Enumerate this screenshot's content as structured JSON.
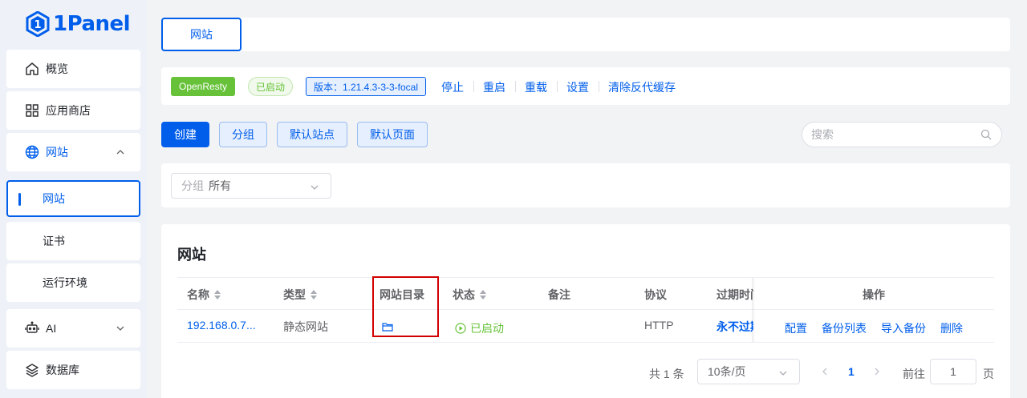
{
  "app": {
    "name": "1Panel"
  },
  "sidebar": {
    "items": [
      {
        "label": "概览",
        "icon": "home-icon"
      },
      {
        "label": "应用商店",
        "icon": "grid-icon"
      },
      {
        "label": "网站",
        "icon": "globe-icon",
        "expanded": true
      },
      {
        "label": "网站",
        "active": true
      },
      {
        "label": "证书"
      },
      {
        "label": "运行环境"
      },
      {
        "label": "AI",
        "icon": "robot-icon"
      },
      {
        "label": "数据库",
        "icon": "layers-icon"
      }
    ]
  },
  "tabs": {
    "active": "网站"
  },
  "status_bar": {
    "app_tag": "OpenResty",
    "state_tag": "已启动",
    "version_tag": "版本：1.21.4.3-3-3-focal",
    "actions": [
      "停止",
      "重启",
      "重载",
      "设置",
      "清除反代缓存"
    ]
  },
  "toolbar": {
    "create": "创建",
    "group": "分组",
    "default_site": "默认站点",
    "default_page": "默认页面",
    "search_placeholder": "搜索"
  },
  "filter": {
    "label": "分组",
    "value": "所有"
  },
  "table": {
    "title": "网站",
    "columns": [
      "名称",
      "类型",
      "网站目录",
      "状态",
      "备注",
      "协议",
      "过期时间",
      "操作"
    ],
    "rows": [
      {
        "name": "192.168.0.7...",
        "type": "静态网站",
        "status": "已启动",
        "remark": "",
        "protocol": "HTTP",
        "expire": "永不过期",
        "ops": [
          "配置",
          "备份列表",
          "导入备份",
          "删除"
        ]
      }
    ]
  },
  "pagination": {
    "total": "共 1 条",
    "page_size": "10条/页",
    "current": "1",
    "goto_label": "前往",
    "goto_value": "1",
    "page_suffix": "页"
  },
  "colors": {
    "accent": "#005eeb",
    "success": "#67c23a",
    "highlight": "#d10000"
  }
}
